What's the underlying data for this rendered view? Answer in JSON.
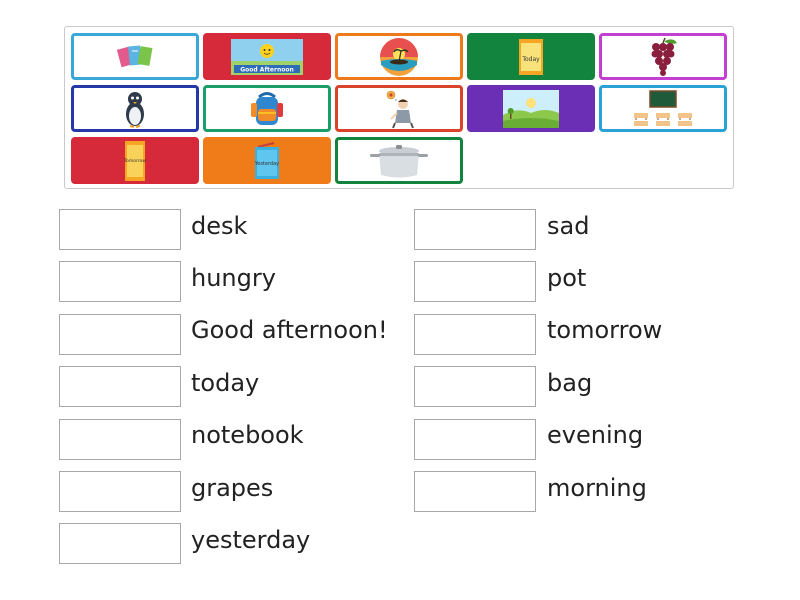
{
  "tiles": [
    {
      "id": "notebooks",
      "icon": "notebooks-icon",
      "border": "#3aa7d9",
      "bg": "#ffffff"
    },
    {
      "id": "good-afternoon",
      "icon": "good-afternoon-card-icon",
      "border": "#d62a3a",
      "bg": "#d62a3a",
      "caption": "Good Afternoon"
    },
    {
      "id": "evening",
      "icon": "sunset-island-icon",
      "border": "#ee7a1b",
      "bg": "#ffffff"
    },
    {
      "id": "today",
      "icon": "today-note-icon",
      "border": "#12843d",
      "bg": "#12843d",
      "caption": "Today"
    },
    {
      "id": "grapes",
      "icon": "grapes-icon",
      "border": "#c23fd1",
      "bg": "#ffffff"
    },
    {
      "id": "penguin",
      "icon": "sad-penguin-icon",
      "border": "#2438a8",
      "bg": "#ffffff"
    },
    {
      "id": "bag",
      "icon": "backpack-icon",
      "border": "#1a9e6a",
      "bg": "#ffffff"
    },
    {
      "id": "hungry",
      "icon": "hungry-man-icon",
      "border": "#d9432a",
      "bg": "#ffffff"
    },
    {
      "id": "morning",
      "icon": "morning-landscape-icon",
      "border": "#6a2fb5",
      "bg": "#6a2fb5"
    },
    {
      "id": "desk",
      "icon": "classroom-desk-icon",
      "border": "#29a3d6",
      "bg": "#ffffff"
    },
    {
      "id": "tomorrow",
      "icon": "tomorrow-note-icon",
      "border": "#d62a3a",
      "bg": "#d62a3a",
      "caption": "Tomorrow"
    },
    {
      "id": "yesterday",
      "icon": "yesterday-note-icon",
      "border": "#ef7c18",
      "bg": "#ef7c18",
      "caption": "Yesterday"
    },
    {
      "id": "pot",
      "icon": "cooking-pot-icon",
      "border": "#12843d",
      "bg": "#ffffff"
    }
  ],
  "left_words": [
    "desk",
    "hungry",
    "Good afternoon!",
    "today",
    "notebook",
    "grapes",
    "yesterday"
  ],
  "right_words": [
    "sad",
    "pot",
    "tomorrow",
    "bag",
    "evening",
    "morning"
  ]
}
